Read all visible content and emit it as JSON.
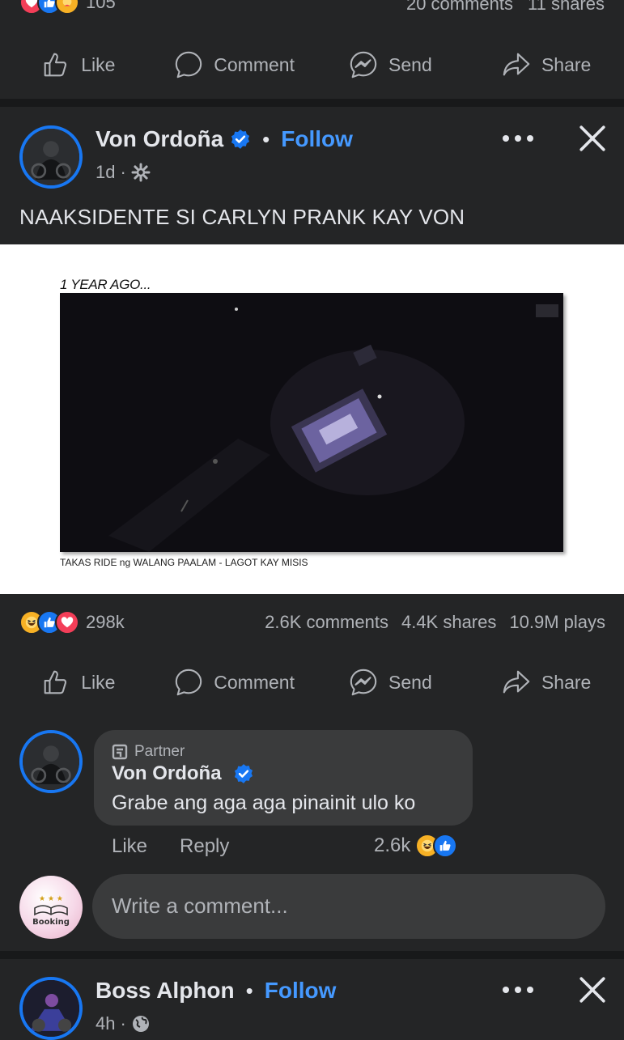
{
  "top_post": {
    "reaction_count": "105",
    "comments": "20 comments",
    "shares": "11 shares"
  },
  "actions": {
    "like": "Like",
    "comment": "Comment",
    "send": "Send",
    "share": "Share"
  },
  "post": {
    "author": "Von Ordoña",
    "follow": "Follow",
    "time": "1d",
    "caption": "NAAKSIDENTE SI CARLYN PRANK KAY VON",
    "media": {
      "overlay_top": "1 YEAR AGO...",
      "overlay_bottom": "TAKAS RIDE ng WALANG PAALAM - LAGOT KAY MISIS"
    },
    "reaction_count": "298k",
    "comments": "2.6K comments",
    "shares": "4.4K shares",
    "plays": "10.9M plays"
  },
  "comment": {
    "badge": "Partner",
    "author": "Von Ordoña",
    "text": "Grabe ang aga aga pinainit ulo ko",
    "like": "Like",
    "reply": "Reply",
    "reaction_count": "2.6k"
  },
  "write_comment": {
    "placeholder": "Write a comment...",
    "avatar_label": "Booking"
  },
  "next_post": {
    "author": "Boss Alphon",
    "follow": "Follow",
    "time": "4h"
  },
  "colors": {
    "background": "#242526",
    "divider": "#18191a",
    "accent": "#4599ff",
    "verified": "#1877f2"
  }
}
